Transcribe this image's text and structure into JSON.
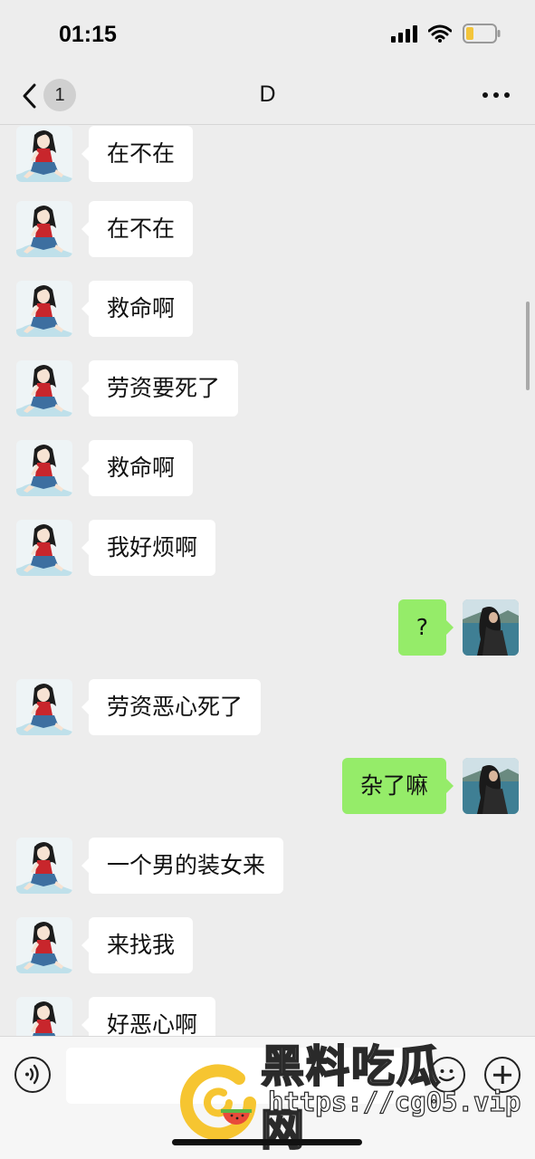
{
  "status_bar": {
    "time": "01:15"
  },
  "nav": {
    "back_badge": "1",
    "title": "D"
  },
  "messages": [
    {
      "side": "left",
      "text": "在不在"
    },
    {
      "side": "left",
      "text": "在不在"
    },
    {
      "side": "left",
      "text": "救命啊"
    },
    {
      "side": "left",
      "text": "劳资要死了"
    },
    {
      "side": "left",
      "text": "救命啊"
    },
    {
      "side": "left",
      "text": "我好烦啊"
    },
    {
      "side": "right",
      "text": "?"
    },
    {
      "side": "left",
      "text": "劳资恶心死了"
    },
    {
      "side": "right",
      "text": "杂了嘛"
    },
    {
      "side": "left",
      "text": "一个男的装女来"
    },
    {
      "side": "left",
      "text": "来找我"
    },
    {
      "side": "left",
      "text": "好恶心啊"
    }
  ],
  "input_bar": {
    "value": ""
  },
  "watermark": {
    "name": "黑料吃瓜网",
    "url": "https://cg05.vip"
  },
  "colors": {
    "background": "#ededed",
    "sent_bubble": "#95ec69",
    "received_bubble": "#ffffff"
  },
  "icons": [
    "back-chevron-icon",
    "more-icon",
    "voice-icon",
    "emoji-icon",
    "plus-icon",
    "signal-icon",
    "wifi-icon",
    "battery-icon"
  ]
}
